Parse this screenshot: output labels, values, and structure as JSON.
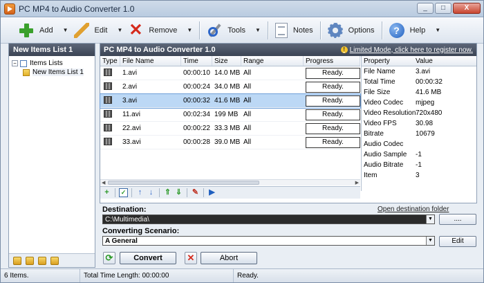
{
  "window": {
    "title": "PC MP4 to Audio Converter 1.0",
    "buttons": {
      "minimize": "_",
      "maximize": "□",
      "close": "X"
    }
  },
  "toolbar": {
    "add": "Add",
    "edit": "Edit",
    "remove": "Remove",
    "tools": "Tools",
    "notes": "Notes",
    "options": "Options",
    "help": "Help"
  },
  "left_panel": {
    "header": "New Items List 1",
    "tree": [
      {
        "label": "Items Lists",
        "toggle": "−"
      },
      {
        "label": "New Items List 1"
      }
    ]
  },
  "right_panel": {
    "header": "PC MP4 to Audio Converter 1.0",
    "register_link": "Limited Mode, click here to register now.",
    "columns": {
      "type": "Type",
      "name": "File Name",
      "time": "Time",
      "size": "Size",
      "range": "Range",
      "progress": "Progress"
    },
    "rows": [
      {
        "name": "1.avi",
        "time": "00:00:10",
        "size": "14.0 MB",
        "range": "All",
        "progress": "Ready."
      },
      {
        "name": "2.avi",
        "time": "00:00:24",
        "size": "34.0 MB",
        "range": "All",
        "progress": "Ready."
      },
      {
        "name": "3.avi",
        "time": "00:00:32",
        "size": "41.6 MB",
        "range": "All",
        "progress": "Ready."
      },
      {
        "name": "11.avi",
        "time": "00:02:34",
        "size": "199 MB",
        "range": "All",
        "progress": "Ready."
      },
      {
        "name": "22.avi",
        "time": "00:00:22",
        "size": "33.3 MB",
        "range": "All",
        "progress": "Ready."
      },
      {
        "name": "33.avi",
        "time": "00:00:28",
        "size": "39.0 MB",
        "range": "All",
        "progress": "Ready."
      }
    ],
    "selected_row": 2,
    "properties": {
      "col_property": "Property",
      "col_value": "Value",
      "items": [
        {
          "k": "File Name",
          "v": "3.avi"
        },
        {
          "k": "Total Time",
          "v": "00:00:32"
        },
        {
          "k": "File Size",
          "v": "41.6 MB"
        },
        {
          "k": "Video Codec",
          "v": "mjpeg"
        },
        {
          "k": "Video Resolution",
          "v": "720x480"
        },
        {
          "k": "Video FPS",
          "v": "30.98"
        },
        {
          "k": "Bitrate",
          "v": "10679"
        },
        {
          "k": "Audio Codec",
          "v": ""
        },
        {
          "k": "Audio Sample",
          "v": "-1"
        },
        {
          "k": "Audio Bitrate",
          "v": "-1"
        },
        {
          "k": "Item",
          "v": "3"
        }
      ]
    }
  },
  "destination": {
    "label": "Destination:",
    "open_link": "Open destination folder",
    "value": "C:\\Multimedia\\",
    "browse": "...."
  },
  "scenario": {
    "label": "Converting Scenario:",
    "value": "A General",
    "edit": "Edit"
  },
  "actions": {
    "convert": "Convert",
    "abort": "Abort"
  },
  "status": {
    "items": "6 Items.",
    "total_time": "Total Time Length: 00:00:00",
    "state": "Ready."
  }
}
